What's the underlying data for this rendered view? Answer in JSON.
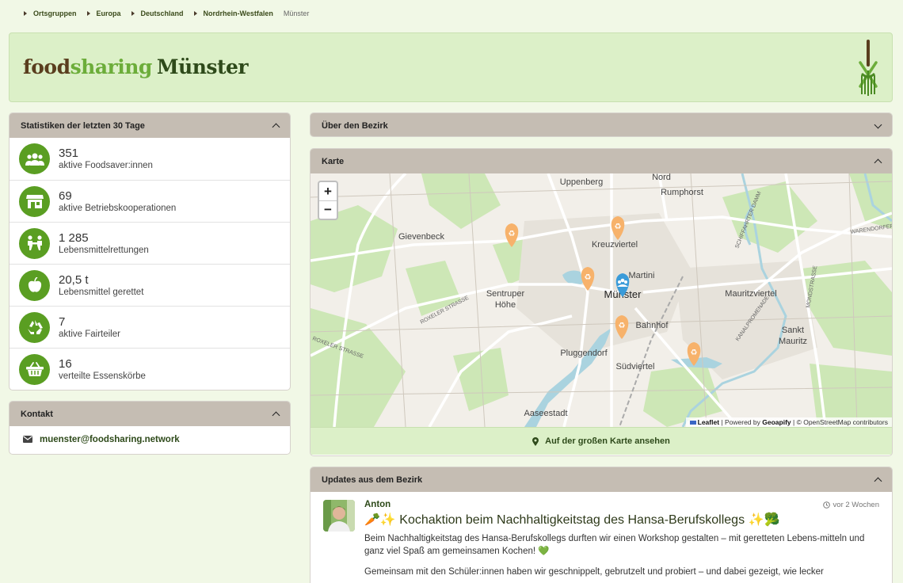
{
  "breadcrumb": [
    {
      "label": "Ortsgruppen"
    },
    {
      "label": "Europa"
    },
    {
      "label": "Deutschland"
    },
    {
      "label": "Nordrhein-Westfalen"
    },
    {
      "label": "Münster"
    }
  ],
  "brand": {
    "food": "food",
    "sharing": "sharing",
    "city": "Münster"
  },
  "stats_panel": {
    "title": "Statistiken der letzten 30 Tage",
    "items": [
      {
        "value": "351",
        "label": "aktive Foodsaver:innen",
        "icon": "users-icon"
      },
      {
        "value": "69",
        "label": "aktive Betriebskooperationen",
        "icon": "store-icon"
      },
      {
        "value": "1 285",
        "label": "Lebensmittelrettungen",
        "icon": "handshake-icon"
      },
      {
        "value": "20,5 t",
        "label": "Lebensmittel gerettet",
        "icon": "apple-icon"
      },
      {
        "value": "7",
        "label": "aktive Fairteiler",
        "icon": "recycle-icon"
      },
      {
        "value": "16",
        "label": "verteilte Essenskörbe",
        "icon": "basket-icon"
      }
    ]
  },
  "contact_panel": {
    "title": "Kontakt",
    "email": "muenster@foodsharing.network"
  },
  "about_panel": {
    "title": "Über den Bezirk"
  },
  "map_panel": {
    "title": "Karte",
    "zoom_in": "+",
    "zoom_out": "−",
    "link_label": "Auf der großen Karte ansehen",
    "attribution": {
      "leaflet": "Leaflet",
      "powered": "| Powered by",
      "geoapify": "Geoapify",
      "osm": "| © OpenStreetMap contributors"
    },
    "places": [
      {
        "name": "Uppenberg"
      },
      {
        "name": "Nord"
      },
      {
        "name": "Rumphorst"
      },
      {
        "name": "Gievenbeck"
      },
      {
        "name": "Kreuzviertel"
      },
      {
        "name": "Martini"
      },
      {
        "name": "Sentruper"
      },
      {
        "name": "Höhe"
      },
      {
        "name": "Münster"
      },
      {
        "name": "Mauritzviertel"
      },
      {
        "name": "Bahnhof"
      },
      {
        "name": "Sankt"
      },
      {
        "name": "Mauritz"
      },
      {
        "name": "Pluggendorf"
      },
      {
        "name": "Südviertel"
      },
      {
        "name": "Aaseestadt"
      }
    ],
    "streets": [
      {
        "name": "ROXELER STRASSE"
      },
      {
        "name": "ROXELER STRASSE"
      },
      {
        "name": "SCHIFFAHRTER DAMM"
      },
      {
        "name": "WARENDORFER"
      },
      {
        "name": "MONDSTRASSE"
      },
      {
        "name": "KANALPROMENADE"
      }
    ]
  },
  "updates_panel": {
    "title": "Updates aus dem Bezirk",
    "post": {
      "author": "Anton",
      "time": "vor 2 Wochen",
      "title": "🥕✨ Kochaktion beim Nachhaltigkeitstag des Hansa-Berufskollegs ✨🥦",
      "text1": "Beim Nachhaltigkeitstag des Hansa-Berufskollegs durften wir einen Workshop gestalten – mit geretteten Lebens-mitteln und ganz viel Spaß am gemeinsamen Kochen! 💚",
      "text2": "Gemeinsam mit den Schüler:innen haben wir geschnippelt, gebrutzelt und probiert – und dabei gezeigt, wie lecker"
    }
  },
  "colors": {
    "accent": "#5a9e22",
    "panel_head": "#c5bdb3",
    "banner": "#dcf0c8",
    "marker": "#f7b26b",
    "marker_main": "#3a9bd9"
  }
}
